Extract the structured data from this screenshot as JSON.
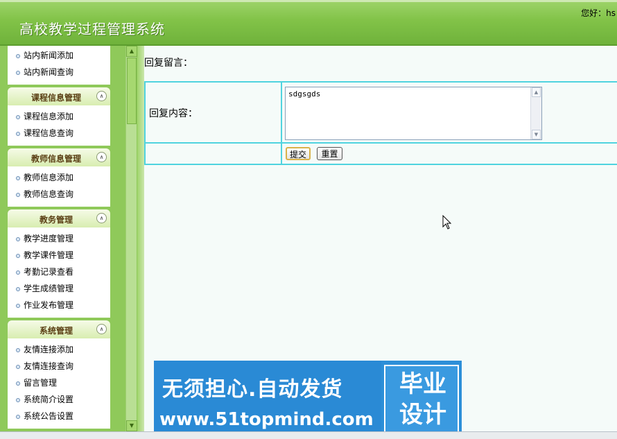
{
  "header": {
    "title": "高校教学过程管理系统",
    "greeting": "您好：hs"
  },
  "sidebar": {
    "top_items": [
      "站内新闻添加",
      "站内新闻查询"
    ],
    "panels": [
      {
        "title": "课程信息管理",
        "items": [
          "课程信息添加",
          "课程信息查询"
        ]
      },
      {
        "title": "教师信息管理",
        "items": [
          "教师信息添加",
          "教师信息查询"
        ]
      },
      {
        "title": "教务管理",
        "items": [
          "教学进度管理",
          "教学课件管理",
          "考勤记录查看",
          "学生成绩管理",
          "作业发布管理"
        ]
      },
      {
        "title": "系统管理",
        "items": [
          "友情连接添加",
          "友情连接查询",
          "留言管理",
          "系统简介设置",
          "系统公告设置"
        ]
      }
    ],
    "panel_toggle_icon": "collapse-up-icon",
    "scroll_up_icon": "arrow-up-icon",
    "scroll_down_icon": "arrow-down-icon"
  },
  "main": {
    "heading": "回复留言：",
    "form": {
      "content_label": "回复内容：",
      "content_value": "sdgsgds",
      "submit_label": "提交",
      "reset_label": "重置"
    }
  },
  "watermark": {
    "slogan": "无须担心.自动发货",
    "url": "www.51topmind.com",
    "badge": "毕业\n设计"
  },
  "colors": {
    "header_green": "#82c348",
    "sidebar_green": "#8fc95a",
    "table_border": "#4fd3df",
    "main_bg": "#f5fbf9",
    "watermark_blue": "#2d8fd8"
  }
}
